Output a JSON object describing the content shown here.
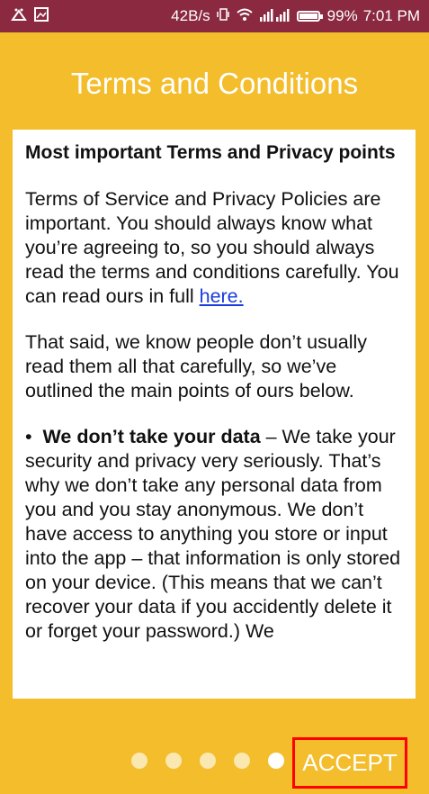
{
  "status_bar": {
    "speed": "42B/s",
    "battery_percent": "99%",
    "time": "7:01 PM",
    "icons": [
      "notification-icon",
      "image-icon",
      "vibrate-icon",
      "wifi-icon",
      "signal-icon",
      "battery-icon"
    ]
  },
  "page": {
    "title": "Terms and Conditions"
  },
  "content": {
    "heading": "Most important Terms and Privacy points",
    "para1_text": "Terms of Service and Privacy Policies are important. You should always know what you’re agreeing to, so you should always read the terms and conditions carefully. You can read ours in full ",
    "para1_link": "here.",
    "para2": "That said, we know people don’t usually read them all that carefully, so we’ve outlined the main points of ours below.",
    "bullet1_mark": "•",
    "bullet1_bold": "We don’t take your data",
    "bullet1_text": " – We take your security and privacy very seriously. That’s why we don’t take any personal data from you and you stay anonymous. We don’t have access to anything you store or input into the app – that information is only stored on your device. (This means that we can’t recover your data if you accidently delete it or forget your password.) We"
  },
  "pager": {
    "total": 5,
    "active_index": 4
  },
  "actions": {
    "accept_label": "ACCEPT"
  },
  "colors": {
    "background": "#f3bd2c",
    "status_bar": "#8a2940",
    "link": "#1a3cdc",
    "highlight_border": "#ff0000"
  }
}
